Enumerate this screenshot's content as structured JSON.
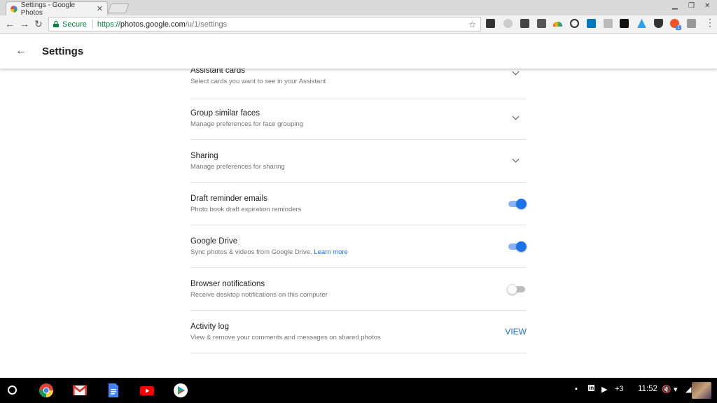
{
  "browser": {
    "tab_title": "Settings - Google Photos",
    "tab_close": "✕",
    "secure_label": "Secure",
    "url_scheme": "https://",
    "url_host": "photos.google.com",
    "url_path": "/u/1/settings",
    "badge_count": "1"
  },
  "appbar": {
    "back_glyph": "←",
    "title": "Settings"
  },
  "settings": [
    {
      "title": "Assistant cards",
      "desc": "Select cards you want to see in your Assistant",
      "control": "chevron"
    },
    {
      "title": "Group similar faces",
      "desc": "Manage preferences for face grouping",
      "control": "chevron"
    },
    {
      "title": "Sharing",
      "desc": "Manage preferences for sharing",
      "control": "chevron"
    },
    {
      "title": "Draft reminder emails",
      "desc": "Photo book draft expiration reminders",
      "control": "toggle",
      "on": true
    },
    {
      "title": "Google Drive",
      "desc": "Sync photos & videos from Google Drive.",
      "link": "Learn more",
      "control": "toggle",
      "on": true
    },
    {
      "title": "Browser notifications",
      "desc": "Receive desktop notifications on this computer",
      "control": "toggle",
      "on": false
    },
    {
      "title": "Activity log",
      "desc": "View & remove your comments and messages on shared photos",
      "control": "button",
      "button_label": "VIEW"
    }
  ],
  "shelf": {
    "notification_count": "+3",
    "time": "11:52"
  },
  "colors": {
    "accent": "#1a73e8",
    "secure": "#0b8043"
  }
}
